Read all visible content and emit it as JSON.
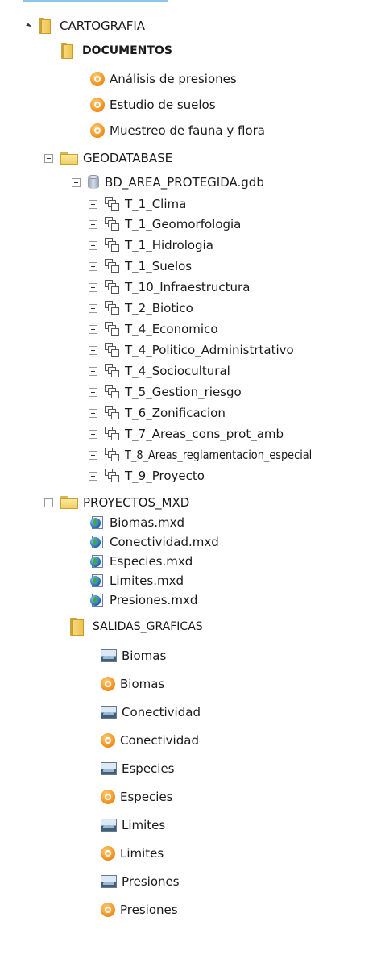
{
  "tree": {
    "root": {
      "label": "CARTOGRAFIA",
      "icon": "folder-icon",
      "expander": "expanded-triangle"
    },
    "documentos": {
      "label": "DOCUMENTOS",
      "items": [
        "Análisis de presiones",
        "Estudio de suelos",
        "Muestreo de fauna y flora"
      ]
    },
    "geodatabase": {
      "label": "GEODATABASE",
      "gdb": {
        "label": "BD_AREA_PROTEGIDA.gdb",
        "datasets": [
          "T_1_Clima",
          "T_1_Geomorfologia",
          "T_1_Hidrologia",
          "T_1_Suelos",
          "T_10_Infraestructura",
          "T_2_Biotico",
          "T_4_Economico",
          "T_4_Politico_Administrtativo",
          "T_4_Sociocultural",
          "T_5_Gestion_riesgo",
          "T_6_Zonificacion",
          "T_7_Areas_cons_prot_amb",
          "T_8_Areas_reglamentacion_especial",
          "T_9_Proyecto"
        ]
      }
    },
    "proyectos": {
      "label": "PROYECTOS_MXD",
      "items": [
        "Biomas.mxd",
        "Conectividad.mxd",
        "Especies.mxd",
        "Limites.mxd",
        "Presiones.mxd"
      ]
    },
    "salidas": {
      "label": "SALIDAS_GRAFICAS",
      "items": [
        {
          "label": "Biomas",
          "icon": "image-icon"
        },
        {
          "label": "Biomas",
          "icon": "pdf-document-icon"
        },
        {
          "label": "Conectividad",
          "icon": "image-icon"
        },
        {
          "label": "Conectividad",
          "icon": "pdf-document-icon"
        },
        {
          "label": "Especies",
          "icon": "image-icon"
        },
        {
          "label": "Especies",
          "icon": "pdf-document-icon"
        },
        {
          "label": "Limites",
          "icon": "image-icon"
        },
        {
          "label": "Limites",
          "icon": "pdf-document-icon"
        },
        {
          "label": "Presiones",
          "icon": "image-icon"
        },
        {
          "label": "Presiones",
          "icon": "pdf-document-icon"
        }
      ]
    }
  }
}
